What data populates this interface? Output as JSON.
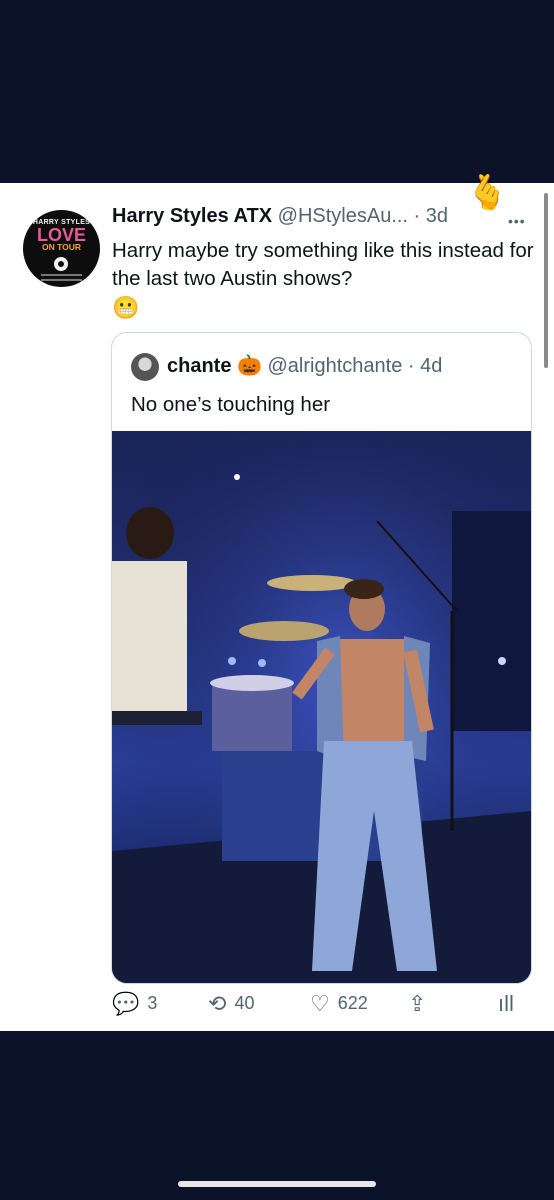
{
  "tweet": {
    "author_name": "Harry Styles ATX",
    "author_handle": "@HStylesAu...",
    "separator": "·",
    "timestamp": "3d",
    "more_icon": "more-icon",
    "text": "Harry maybe try something like this instead for the last two Austin shows?",
    "emoji": "😬",
    "sticker_emoji": "🫰",
    "avatar": {
      "line1": "HARRY STYLES",
      "line2": "LOVE",
      "line3": "ON TOUR"
    }
  },
  "quote": {
    "author_name": "chante",
    "author_emoji": "🎃",
    "author_handle": "@alrightchante",
    "separator": "·",
    "timestamp": "4d",
    "text": "No one’s touching her",
    "image": "concert-photo"
  },
  "actions": {
    "reply_count": "3",
    "retweet_count": "40",
    "like_count": "622"
  },
  "colors": {
    "background": "#0b1229",
    "text_primary": "#0f1419",
    "text_secondary": "#536471",
    "border": "#cfd9de"
  }
}
